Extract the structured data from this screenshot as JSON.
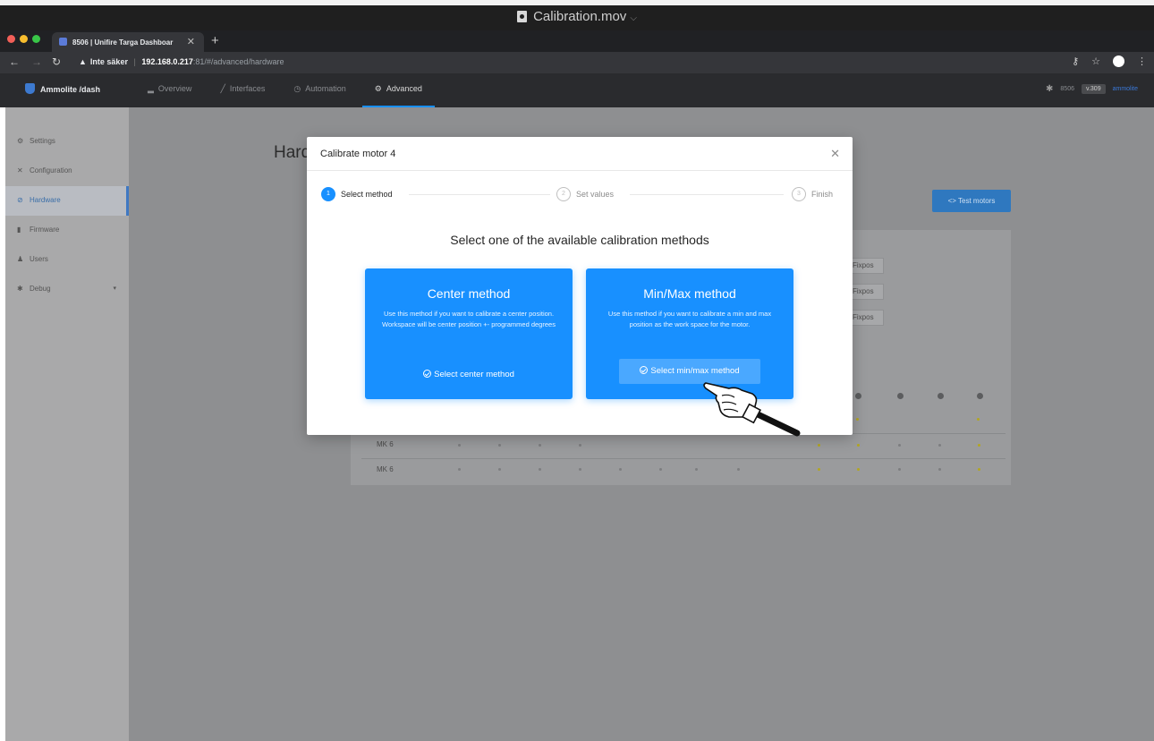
{
  "quicktime": {
    "title": "Calibration.mov"
  },
  "browser": {
    "tab_title": "8506 | Unifire Targa Dashboar",
    "security_label": "Inte säker",
    "url_host": "192.168.0.217",
    "url_path": ":81/#/advanced/hardware"
  },
  "app": {
    "brand": "Ammolite /dash",
    "nav": [
      {
        "label": "Overview",
        "icon": "chart-icon"
      },
      {
        "label": "Interfaces",
        "icon": "pencil-icon"
      },
      {
        "label": "Automation",
        "icon": "clock-icon"
      },
      {
        "label": "Advanced",
        "icon": "gear-icon",
        "active": true
      }
    ],
    "header_right": {
      "device": "8506",
      "version": "v.309",
      "user": "ammolite"
    }
  },
  "sidebar": {
    "items": [
      {
        "label": "Settings",
        "icon": "gear-icon"
      },
      {
        "label": "Configuration",
        "icon": "tools-icon"
      },
      {
        "label": "Hardware",
        "icon": "chip-icon",
        "active": true
      },
      {
        "label": "Firmware",
        "icon": "file-icon"
      },
      {
        "label": "Users",
        "icon": "user-icon"
      },
      {
        "label": "Debug",
        "icon": "bug-icon"
      }
    ]
  },
  "page": {
    "title": "Hard",
    "test_motors_label": "<> Test motors",
    "fixpos_label": "Fixpos",
    "rows": [
      "MK 6",
      "MK 6"
    ]
  },
  "modal": {
    "title": "Calibrate motor 4",
    "steps": [
      {
        "number": "1",
        "label": "Select method",
        "active": true
      },
      {
        "number": "2",
        "label": "Set values"
      },
      {
        "number": "3",
        "label": "Finish"
      }
    ],
    "heading": "Select one of the available calibration methods",
    "methods": [
      {
        "title": "Center method",
        "description": "Use this method if you want to calibrate a center position. Workspace will be center position +- programmed degrees",
        "button": "Select center method"
      },
      {
        "title": "Min/Max method",
        "description": "Use this method if you want to calibrate a min and max position as the work space for the motor.",
        "button": "Select min/max method"
      }
    ]
  },
  "colors": {
    "primary": "#1890ff",
    "overlay": "#8e8f91",
    "header": "#2a2b2e"
  }
}
